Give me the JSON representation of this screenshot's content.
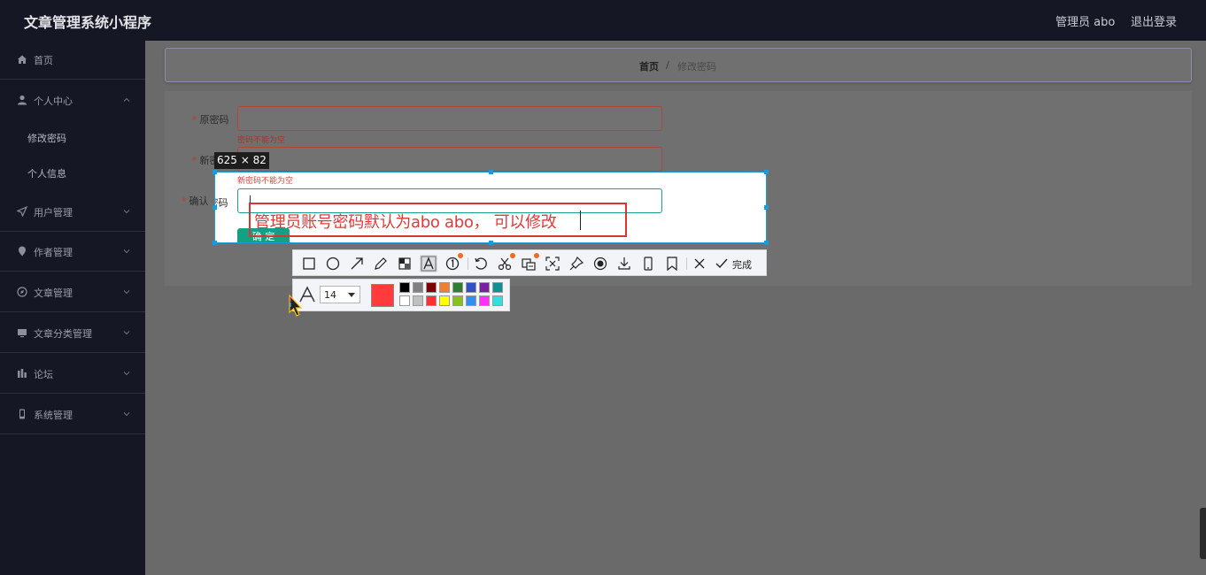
{
  "app": {
    "title": "文章管理系统小程序"
  },
  "header": {
    "admin_label": "管理员 abo",
    "logout": "退出登录"
  },
  "sidebar": {
    "items": [
      {
        "label": "首页",
        "icon": "home-icon"
      },
      {
        "label": "个人中心",
        "icon": "user-icon",
        "expanded": true,
        "children": [
          {
            "label": "修改密码"
          },
          {
            "label": "个人信息"
          }
        ]
      },
      {
        "label": "用户管理",
        "icon": "send-icon"
      },
      {
        "label": "作者管理",
        "icon": "location-icon"
      },
      {
        "label": "文章管理",
        "icon": "compass-icon"
      },
      {
        "label": "文章分类管理",
        "icon": "monitor-icon"
      },
      {
        "label": "论坛",
        "icon": "chart-icon"
      },
      {
        "label": "系统管理",
        "icon": "mobile-icon"
      }
    ]
  },
  "breadcrumb": {
    "home": "首页",
    "separator": "/",
    "current": "修改密码"
  },
  "form": {
    "old_password": {
      "label": "原密码",
      "error": "密码不能为空"
    },
    "new_password": {
      "label": "新密码",
      "label_visible": "新密",
      "error": "新密码不能为空"
    },
    "confirm_password": {
      "label": "确认密码"
    },
    "submit_label": "确 定"
  },
  "capture": {
    "size_label": "625 × 82",
    "annotation_text": "管理员账号密码默认为abo abo， 可以修改"
  },
  "toolbar": {
    "tools": [
      "rectangle-icon",
      "ellipse-icon",
      "arrow-icon",
      "pencil-icon",
      "mosaic-icon",
      "text-icon",
      "serial-number-icon",
      "undo-icon",
      "cut-icon",
      "ocr-icon",
      "full-screen-icon",
      "pin-icon",
      "record-icon",
      "download-icon",
      "phone-icon",
      "bookmark-icon",
      "close-icon"
    ],
    "done_label": "完成"
  },
  "text_options": {
    "font_size": "14",
    "current_color": "#ff3b3b",
    "palette": [
      "#000000",
      "#808080",
      "#800000",
      "#f08030",
      "#2e7d32",
      "#3050c8",
      "#7b1fa2",
      "#109090",
      "#ffffff",
      "#c0c0c0",
      "#ff3030",
      "#ffff00",
      "#88c020",
      "#3090f0",
      "#ff30ff",
      "#30e0e0"
    ]
  }
}
